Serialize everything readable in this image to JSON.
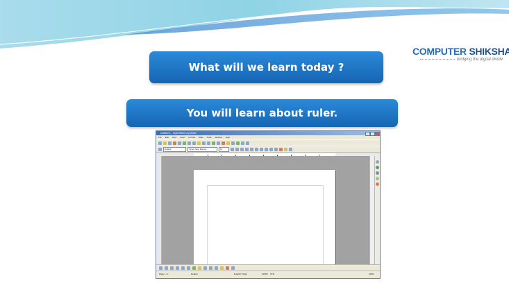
{
  "slide": {
    "question": "What will we learn today ?",
    "answer": "You will learn about ruler."
  },
  "logo": {
    "name_part1": "COMPUTER",
    "name_part2": "SHIKSHA",
    "tagline": "bridging the digital divide"
  },
  "colors": {
    "pill_blue": "#1e78c8",
    "banner_blue": "#8fd3e6",
    "logo_blue": "#2a6db5"
  },
  "screenshot": {
    "window_title": "Untitled 1 - OpenOffice.org Writer",
    "menu": [
      "File",
      "Edit",
      "View",
      "Insert",
      "Format",
      "Table",
      "Tools",
      "Window",
      "Help"
    ],
    "paragraph_style": "Default",
    "font_name": "Times New Roman",
    "font_size": "12",
    "status": {
      "page": "Page 1 / 1",
      "style": "Default",
      "language": "English (USA)",
      "mode": "INSRT",
      "selection": "STD",
      "zoom": "100%"
    }
  }
}
